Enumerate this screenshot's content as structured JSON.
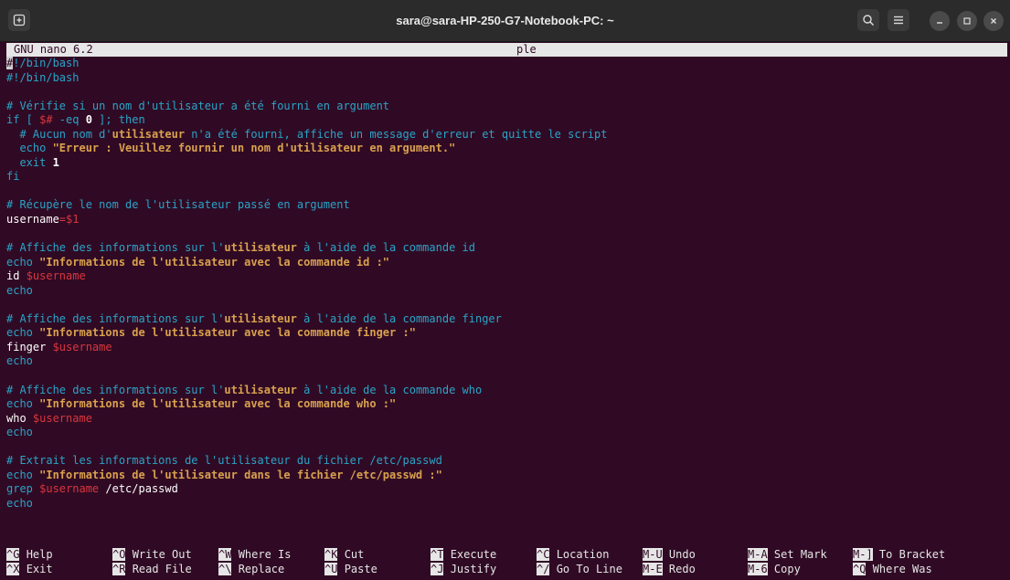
{
  "window": {
    "title": "sara@sara-HP-250-G7-Notebook-PC: ~"
  },
  "nano": {
    "version": "GNU nano 6.2",
    "filename": "ple"
  },
  "code": {
    "l0b": "!/bin/bash",
    "l1": "#!/bin/bash",
    "l3": "# Vérifie si un nom d'utilisateur a été fourni en argument",
    "l4a": "if [ ",
    "l4b": "$#",
    "l4c": " -eq ",
    "l4d": "0",
    "l4e": " ]; then",
    "l5a": "  # Aucun nom d'",
    "l5b": "utilisateur",
    "l5c": " n'",
    "l5d": "a été fourni, affiche un message d'erreur et quitte le script",
    "l6a": "  echo ",
    "l6b": "\"Erreur : Veuillez fournir un nom d'utilisateur en argument.\"",
    "l7a": "  exit ",
    "l7b": "1",
    "l8": "fi",
    "l10": "# Récupère le nom de l'utilisateur passé en argument",
    "l11a": "username",
    "l11b": "=$1",
    "l13a": "# Affiche des informations sur l'",
    "l13b": "utilisateur",
    "l13c": " à l'aide de la commande id",
    "l14a": "echo ",
    "l14b": "\"Informations de l'utilisateur avec la commande id :\"",
    "l15a": "id ",
    "l15b": "$username",
    "l16": "echo",
    "l18a": "# Affiche des informations sur l'",
    "l18b": "utilisateur",
    "l18c": " à l'aide de la commande finger",
    "l19a": "echo ",
    "l19b": "\"Informations de l'utilisateur avec la commande finger :\"",
    "l20a": "finger ",
    "l20b": "$username",
    "l21": "echo",
    "l23a": "# Affiche des informations sur l'",
    "l23b": "utilisateur",
    "l23c": " à l'aide de la commande who",
    "l24a": "echo ",
    "l24b": "\"Informations de l'utilisateur avec la commande who :\"",
    "l25a": "who ",
    "l25b": "$username",
    "l26": "echo",
    "l28": "# Extrait les informations de l'utilisateur du fichier /etc/passwd",
    "l29a": "echo ",
    "l29b": "\"Informations de l'utilisateur dans le fichier /etc/passwd :\"",
    "l30a": "grep ",
    "l30b": "$username",
    "l30c": " /etc/passwd",
    "l31": "echo"
  },
  "shortcuts": [
    {
      "key": "^G",
      "label": "Help"
    },
    {
      "key": "^X",
      "label": "Exit"
    },
    {
      "key": "^O",
      "label": "Write Out"
    },
    {
      "key": "^R",
      "label": "Read File"
    },
    {
      "key": "^W",
      "label": "Where Is"
    },
    {
      "key": "^\\",
      "label": "Replace"
    },
    {
      "key": "^K",
      "label": "Cut"
    },
    {
      "key": "^U",
      "label": "Paste"
    },
    {
      "key": "^T",
      "label": "Execute"
    },
    {
      "key": "^J",
      "label": "Justify"
    },
    {
      "key": "^C",
      "label": "Location"
    },
    {
      "key": "^/",
      "label": "Go To Line"
    },
    {
      "key": "M-U",
      "label": "Undo"
    },
    {
      "key": "M-E",
      "label": "Redo"
    },
    {
      "key": "M-A",
      "label": "Set Mark"
    },
    {
      "key": "M-6",
      "label": "Copy"
    },
    {
      "key": "M-]",
      "label": "To Bracket"
    },
    {
      "key": "^Q",
      "label": "Where Was"
    }
  ],
  "icons": {
    "new_tab": "new-tab-icon",
    "search": "search-icon",
    "menu": "hamburger-menu-icon",
    "minimize": "minimize-icon",
    "maximize": "maximize-icon",
    "close": "close-icon"
  }
}
